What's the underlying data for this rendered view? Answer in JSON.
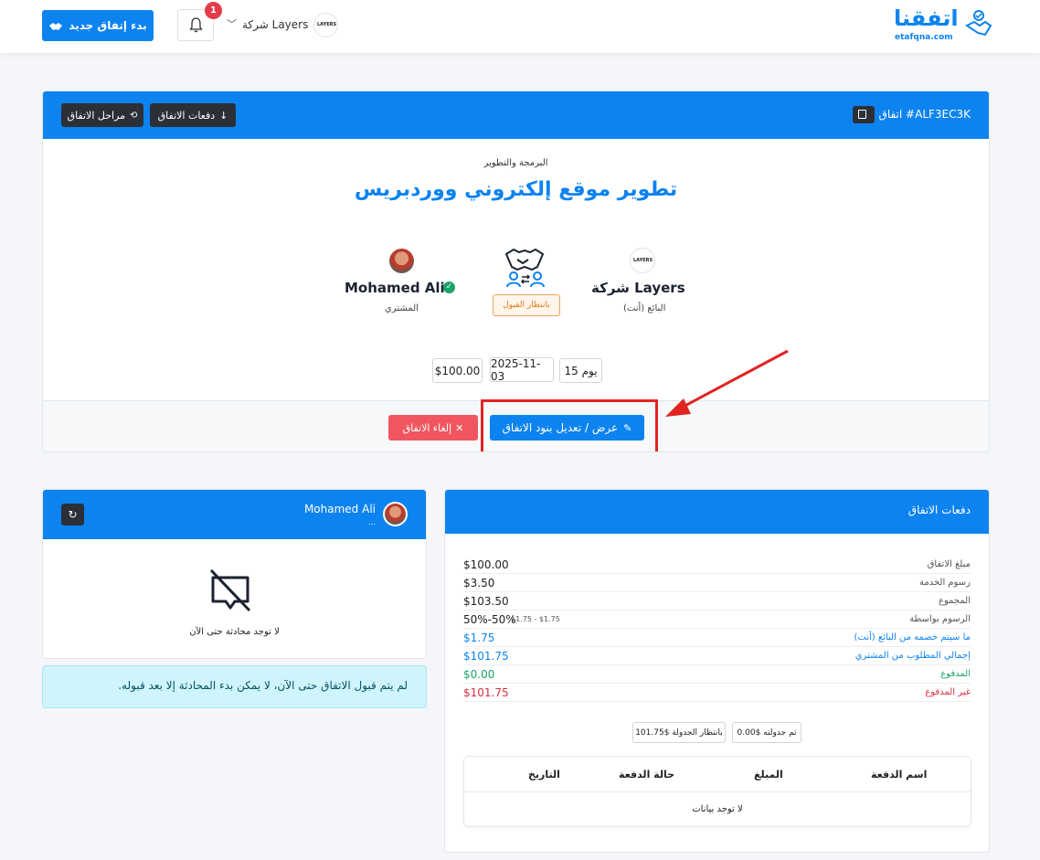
{
  "header": {
    "logo_text": "اتفقنا",
    "logo_sub": "etafqna.com",
    "new_deal_label": "بدء إتفاق جديد",
    "notification_count": "1",
    "company_name": "شركة Layers",
    "company_logo_text": "LAYERS"
  },
  "deal": {
    "id_label": "اتفاق #ALF3EC3K",
    "payments_button": "دفعات الاتفاق",
    "stages_button": "مراحل الاتفاق",
    "category": "البرمجة والتطوير",
    "title": "تطوير موقع إلكتروني ووردبريس",
    "seller_name": "شركة Layers",
    "seller_role": "البائع (أنت)",
    "buyer_name": "Mohamed Ali",
    "buyer_role": "المشتري",
    "status": "بانتظار القبول",
    "duration": "15 يوم",
    "date": "2025-11-03",
    "amount": "$100.00",
    "edit_button": "عرض / تعديل بنود الاتفاق",
    "cancel_button": "إلغاء الاتفاق"
  },
  "payments": {
    "title": "دفعات الاتفاق",
    "rows": [
      {
        "label": "مبلغ الاتفاق",
        "value": "$100.00",
        "extra": ""
      },
      {
        "label": "رسوم الخدمة",
        "value": "$3.50",
        "extra": ""
      },
      {
        "label": "المجموع",
        "value": "$103.50",
        "extra": ""
      },
      {
        "label": "الرسوم بواسطة",
        "value": "50%-50%",
        "extra": "$1.75 - $1.75"
      },
      {
        "label": "ما سيتم خصمه من البائع (أنت)",
        "value": "$1.75",
        "extra": ""
      },
      {
        "label": "إجمالي المطلوب من المشتري",
        "value": "$101.75",
        "extra": ""
      },
      {
        "label": "المدفوع",
        "value": "$0.00",
        "extra": ""
      },
      {
        "label": "غير المدفوع",
        "value": "$101.75",
        "extra": ""
      }
    ],
    "scheduled_chip": "تم جدولته $0.00",
    "pending_chip": "بانتظار الجدولة $101.75",
    "table_headers": [
      "اسم الدفعة",
      "المبلغ",
      "حالة الدفعة",
      "التاريخ"
    ],
    "empty_text": "لا توجد بيانات"
  },
  "chat": {
    "user_name": "Mohamed Ali",
    "user_status": "...",
    "empty_text": "لا توجد محادثة حتى الآن",
    "notice": "لم يتم قبول الاتفاق حتى الآن، لا يمكن بدء المحادثة إلا بعد قبوله."
  },
  "colors": {
    "primary": "#0d83f0",
    "danger": "#f0565f",
    "success": "#1aa36a",
    "highlight": "#e02424"
  }
}
